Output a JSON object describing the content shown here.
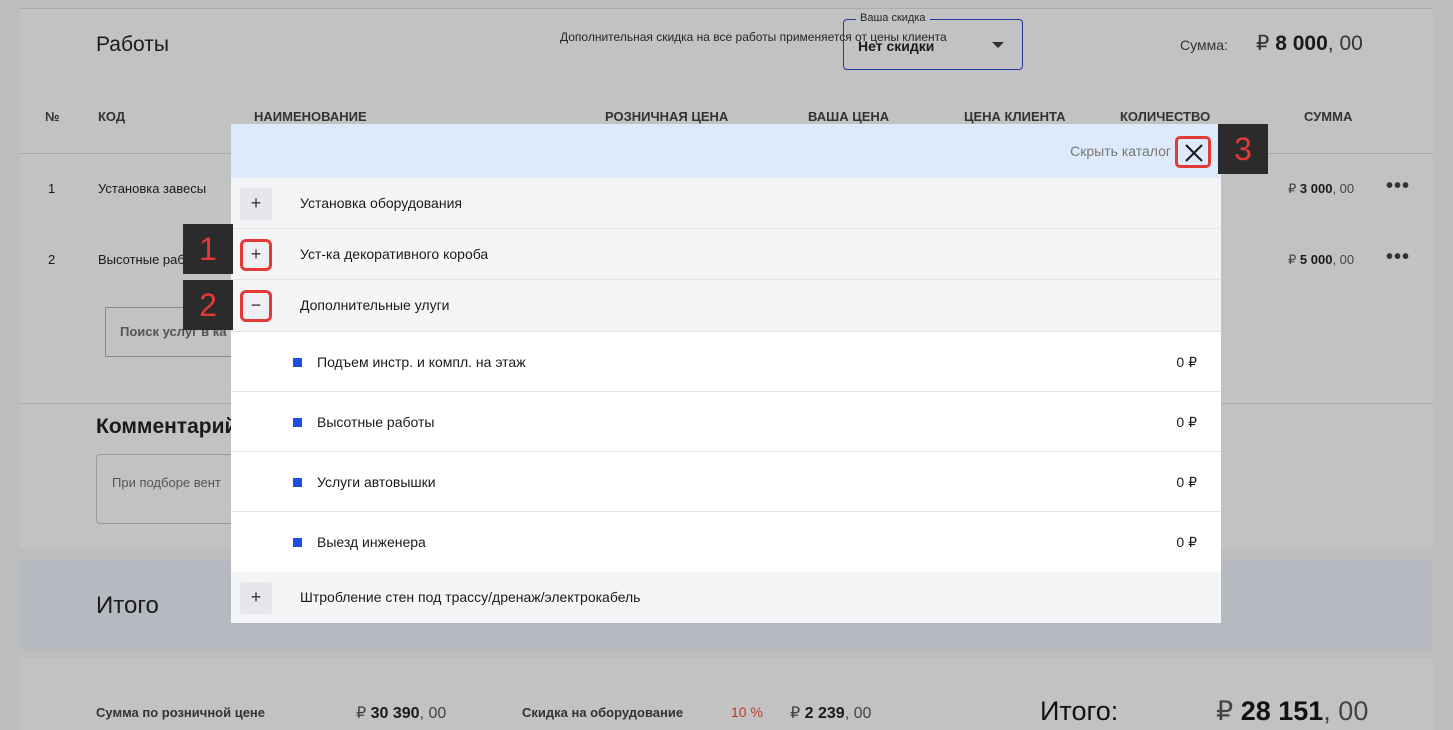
{
  "works": {
    "title": "Работы",
    "discount_note": "Дополнительная скидка на все работы применяется от цены клиента",
    "discount_legend": "Ваша скидка",
    "discount_value": "Нет скидки",
    "sum_label": "Сумма:",
    "sum_currency": "₽",
    "sum_main": "8 000",
    "sum_cents": ", 00",
    "columns": [
      "№",
      "КОД",
      "НАИМЕНОВАНИЕ",
      "РОЗНИЧНАЯ ЦЕНА",
      "ВАША ЦЕНА",
      "ЦЕНА КЛИЕНТА",
      "КОЛИЧЕСТВО",
      "СУММА"
    ],
    "rows": [
      {
        "num": "1",
        "name": "Установка завесы",
        "sum_currency": "₽",
        "sum_main": "3 000",
        "sum_cents": ", 00"
      },
      {
        "num": "2",
        "name": "Высотные работы",
        "sum_currency": "₽",
        "sum_main": "5 000",
        "sum_cents": ", 00"
      }
    ],
    "more_label": "•••",
    "search_placeholder": "Поиск услуг в ка",
    "comment_title": "Комментарий",
    "comment_placeholder": "При подборе вент"
  },
  "itogo": {
    "title": "Итого"
  },
  "totals": {
    "retail_label": "Сумма по розничной цене",
    "retail_currency": "₽",
    "retail_main": "30 390",
    "retail_cents": ", 00",
    "equip_discount_label": "Скидка на оборудование",
    "equip_discount_percent": "10 %",
    "equip_currency": "₽",
    "equip_main": "2 239",
    "equip_cents": ", 00",
    "grand_label": "Итого:",
    "grand_currency": "₽",
    "grand_main": "28 151",
    "grand_cents": ", 00"
  },
  "catalog": {
    "hide_label": "Скрыть каталог",
    "categories": [
      {
        "label": "Установка оборудования",
        "toggle": "+"
      },
      {
        "label": "Уст-ка декоративного короба",
        "toggle": "+"
      },
      {
        "label": "Дополнительные улуги",
        "toggle": "−"
      },
      {
        "label": "Штробление стен под трассу/дренаж/электрокабель",
        "toggle": "+"
      }
    ],
    "subitems": [
      {
        "label": "Подъем инстр. и компл. на этаж",
        "price": "0 ₽"
      },
      {
        "label": "Высотные работы",
        "price": "0 ₽"
      },
      {
        "label": "Услуги автовышки",
        "price": "0 ₽"
      },
      {
        "label": "Выезд инженера",
        "price": "0 ₽"
      }
    ]
  },
  "markers": [
    "1",
    "2",
    "3"
  ],
  "colors": {
    "accent_blue": "#1a4fe0",
    "highlight_red": "#e53935",
    "header_bg": "#ddeafb"
  }
}
